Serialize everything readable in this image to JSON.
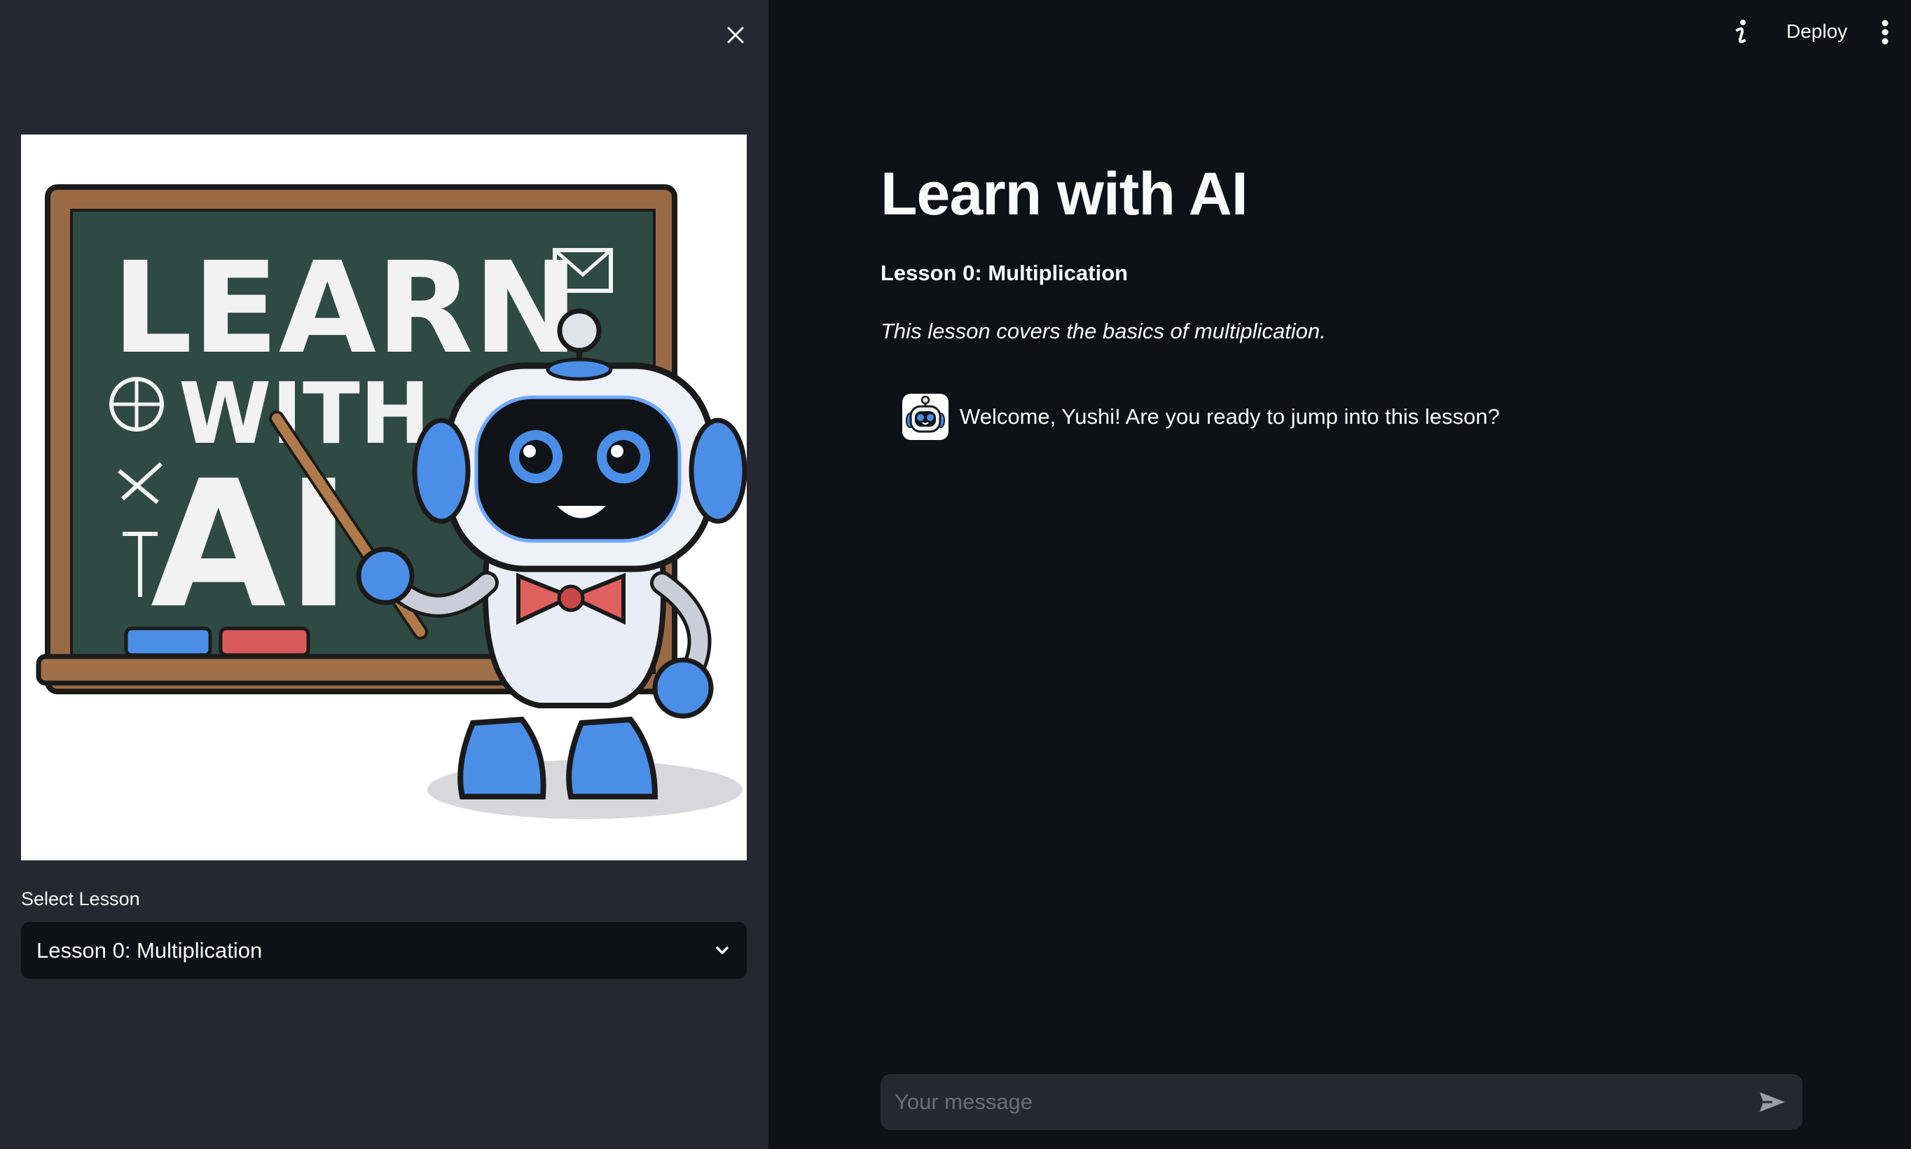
{
  "topbar": {
    "deploy_label": "Deploy"
  },
  "sidebar": {
    "select_label": "Select Lesson",
    "selected_lesson": "Lesson 0: Multiplication",
    "hero_lettering": [
      "LEARN",
      "WITH",
      "AI"
    ]
  },
  "main": {
    "title": "Learn with AI",
    "lesson_heading": "Lesson 0: Multiplication",
    "lesson_description": "This lesson covers the basics of multiplication."
  },
  "chat": {
    "messages": [
      {
        "role": "assistant",
        "avatar": "robot-avatar-icon",
        "text": "Welcome, Yushi! Are you ready to jump into this lesson?"
      }
    ],
    "input_placeholder": "Your message"
  },
  "icons": {
    "close": "close-icon",
    "info": "info-icon",
    "menu": "kebab-menu-icon",
    "dropdown": "chevron-down-icon",
    "send": "send-icon"
  },
  "colors": {
    "main_bg": "#0e1117",
    "sidebar_bg": "#262730",
    "text": "#fafafa",
    "chalkboard": "#2f4a42",
    "robot_blue": "#4a8ee8"
  }
}
